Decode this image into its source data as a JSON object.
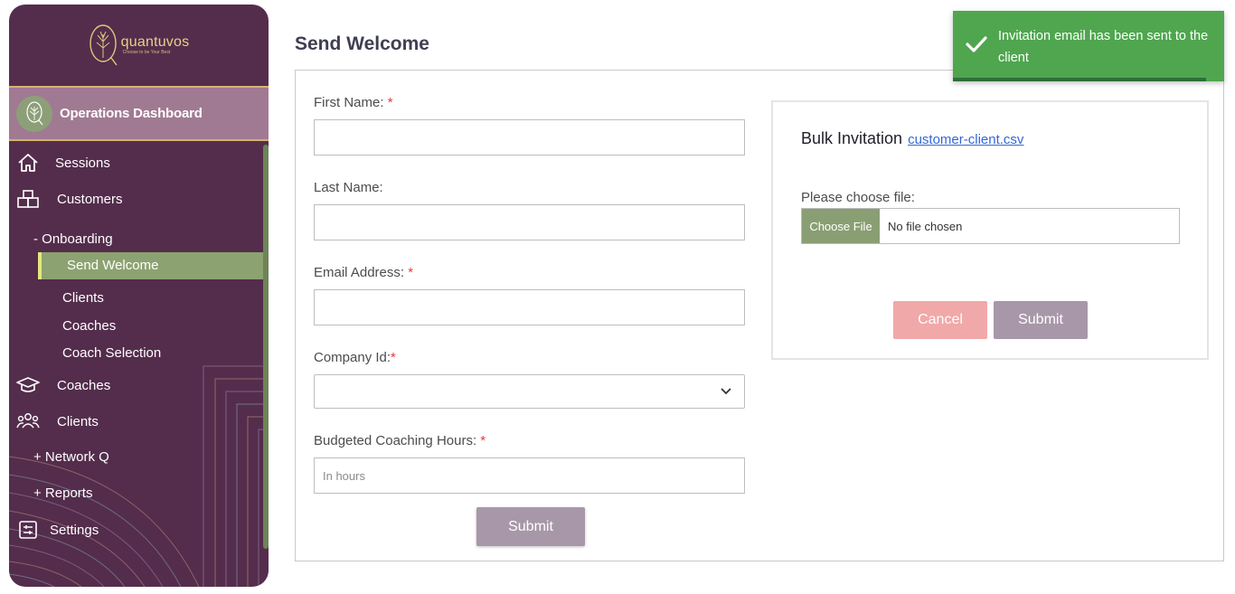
{
  "sidebar": {
    "logo_name": "quantuvos",
    "logo_tagline": "Choose to be Your Best",
    "dashboard_title": "Operations Dashboard",
    "nav": {
      "sessions": "Sessions",
      "customers": "Customers",
      "onboarding": "- Onboarding",
      "send_welcome": "Send Welcome",
      "clients_sub": "Clients",
      "coaches_sub": "Coaches",
      "coach_selection": "Coach Selection",
      "coaches": "Coaches",
      "clients": "Clients",
      "network_q": "+ Network Q",
      "reports": "+ Reports",
      "settings": "Settings"
    }
  },
  "main": {
    "title": "Send Welcome",
    "form": {
      "first_name_label": "First Name:",
      "last_name_label": "Last Name:",
      "email_label": "Email Address:",
      "company_label": "Company Id:",
      "hours_label": "Budgeted Coaching Hours:",
      "required_mark": "*",
      "first_name_value": "",
      "last_name_value": "",
      "email_value": "",
      "company_value": "",
      "hours_placeholder": "In hours",
      "submit_label": "Submit"
    },
    "bulk": {
      "title": "Bulk Invitation",
      "template_link": "customer-client.csv",
      "choose_label": "Please choose file:",
      "choose_button": "Choose File",
      "no_file_text": "No file chosen",
      "cancel_label": "Cancel",
      "submit_label": "Submit"
    }
  },
  "toast": {
    "message": "Invitation email has been sent to the client",
    "icon": "check-icon"
  },
  "colors": {
    "sidebar_bg": "#542d4c",
    "active_item": "#8ca270",
    "toast_success": "#4fa64f",
    "submit_button": "#a897a9",
    "cancel_button": "#f1a8a8",
    "required": "#e23a3a"
  }
}
